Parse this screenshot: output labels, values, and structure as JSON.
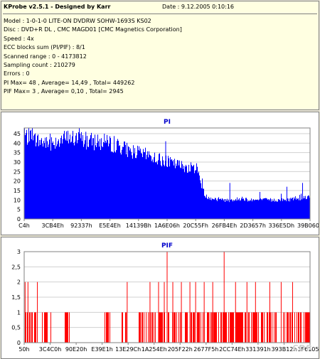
{
  "header": {
    "title": "KProbe v2.5.1 - Designed by Karr",
    "date": "Date : 9.12.2005 0:10:16",
    "lines": [
      "Model : 1-0-1-0 LITE-ON DVDRW SOHW-1693S KS02",
      "Disc : DVD+R DL , CMC MAGD01 [CMC Magnetics Corporation]",
      "Speed : 4x",
      "ECC blocks sum (PI/PIF) : 8/1",
      "Scanned range : 0 - 4173812",
      "Sampling count : 210279",
      "Errors : 0",
      "PI Max= 48 , Average= 14,49 , Total= 449262",
      "PIF Max= 3 , Average= 0,10 , Total= 2945"
    ]
  },
  "chart_data": [
    {
      "type": "bar",
      "title": "PI",
      "color": "#0000ff",
      "ylim": [
        0,
        48
      ],
      "yticks": [
        0,
        5,
        10,
        15,
        20,
        25,
        30,
        35,
        40,
        45
      ],
      "xticks": [
        "C4h",
        "3CB4Eh",
        "92337h",
        "E5E4Eh",
        "14139Bh",
        "1A6E06h",
        "20C55Fh",
        "26FB4Eh",
        "2D3657h",
        "336E5Dh",
        "39B060h"
      ],
      "profile": [
        44,
        42,
        41,
        40,
        41,
        42,
        43,
        42,
        41,
        41,
        40,
        40,
        39,
        38,
        36,
        35,
        34,
        33,
        31,
        30,
        29,
        28,
        27,
        27,
        12,
        11,
        10,
        10,
        10,
        11,
        10,
        10,
        10,
        10,
        10,
        10,
        11,
        11,
        12
      ],
      "spikes": [
        {
          "pos": 0.0,
          "value": 48
        },
        {
          "pos": 0.015,
          "value": 46
        },
        {
          "pos": 0.09,
          "value": 45
        },
        {
          "pos": 0.195,
          "value": 45
        },
        {
          "pos": 0.215,
          "value": 46
        },
        {
          "pos": 0.28,
          "value": 45
        },
        {
          "pos": 0.495,
          "value": 41
        },
        {
          "pos": 0.72,
          "value": 19
        },
        {
          "pos": 0.975,
          "value": 19
        },
        {
          "pos": 0.92,
          "value": 17
        }
      ]
    },
    {
      "type": "bar",
      "title": "PIF",
      "color": "#ff0000",
      "ylim": [
        0,
        3
      ],
      "yticks": [
        0,
        0.5,
        1,
        1.5,
        2,
        2.5,
        3
      ],
      "ytick_labels": [
        "0",
        "0,5",
        "1",
        "1,5",
        "2",
        "2,5",
        "3"
      ],
      "xticks": [
        "50h",
        "3C4C0h",
        "90E20h",
        "E39E1h",
        "13E29Ch",
        "1A254Eh",
        "205F22h",
        "2677F5h",
        "2CC74Eh",
        "331391h",
        "393B12h",
        "3F6105h"
      ],
      "density": [
        1,
        1,
        0,
        1,
        0,
        0,
        0,
        1,
        0,
        0,
        0,
        0,
        0,
        0,
        1,
        0,
        0,
        1,
        0,
        0,
        1,
        1,
        1,
        1,
        1,
        1,
        1,
        1,
        1,
        1,
        1,
        1,
        1,
        1,
        1,
        1,
        1,
        1,
        1,
        1,
        1,
        1,
        1,
        1,
        1,
        1,
        1,
        1,
        1,
        1
      ],
      "spikes": [
        {
          "pos": 0.002,
          "value": 2
        },
        {
          "pos": 0.012,
          "value": 2
        },
        {
          "pos": 0.045,
          "value": 2
        },
        {
          "pos": 0.36,
          "value": 2
        },
        {
          "pos": 0.44,
          "value": 2
        },
        {
          "pos": 0.47,
          "value": 2
        },
        {
          "pos": 0.49,
          "value": 2
        },
        {
          "pos": 0.5,
          "value": 3
        },
        {
          "pos": 0.52,
          "value": 2
        },
        {
          "pos": 0.55,
          "value": 2
        },
        {
          "pos": 0.58,
          "value": 2
        },
        {
          "pos": 0.6,
          "value": 2
        },
        {
          "pos": 0.63,
          "value": 2
        },
        {
          "pos": 0.66,
          "value": 2
        },
        {
          "pos": 0.7,
          "value": 3
        },
        {
          "pos": 0.74,
          "value": 2
        },
        {
          "pos": 0.78,
          "value": 2
        },
        {
          "pos": 0.81,
          "value": 2
        },
        {
          "pos": 0.86,
          "value": 2
        },
        {
          "pos": 0.9,
          "value": 2
        },
        {
          "pos": 0.94,
          "value": 2
        }
      ]
    }
  ]
}
